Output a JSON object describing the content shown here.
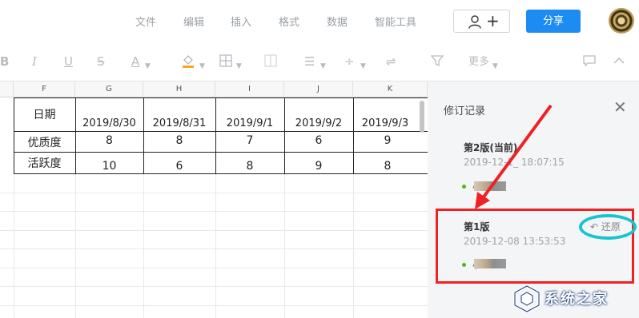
{
  "menu": {
    "items": [
      "文件",
      "编辑",
      "插入",
      "格式",
      "数据",
      "智能工具"
    ],
    "share_label": "分享"
  },
  "toolbar": {
    "bold": "B",
    "italic": "I",
    "underline": "U",
    "strikethrough": "S",
    "font_color": "A",
    "more_label": "更多"
  },
  "sheet": {
    "column_headers": [
      "F",
      "G",
      "H",
      "I",
      "J",
      "K"
    ],
    "rows": [
      [
        "日期",
        "2019/8/30",
        "2019/8/31",
        "2019/9/1",
        "2019/9/2",
        "2019/9/3"
      ],
      [
        "优质度",
        "8",
        "8",
        "7",
        "6",
        "9"
      ],
      [
        "活跃度",
        "10",
        "6",
        "8",
        "9",
        "8"
      ]
    ]
  },
  "panel": {
    "title": "修订记录",
    "versions": [
      {
        "title": "第2版(当前)",
        "time": "2019-12-1_ 18:07:15",
        "user": "小"
      },
      {
        "title": "第1版",
        "time": "2019-12-08 13:53:53",
        "user": "小",
        "restore_label": "还原"
      }
    ]
  },
  "watermark": {
    "text": "系统之家"
  },
  "colors": {
    "accent": "#1c8cf3",
    "annotation_red": "#ee2222",
    "annotation_cyan": "#18c4d2"
  }
}
